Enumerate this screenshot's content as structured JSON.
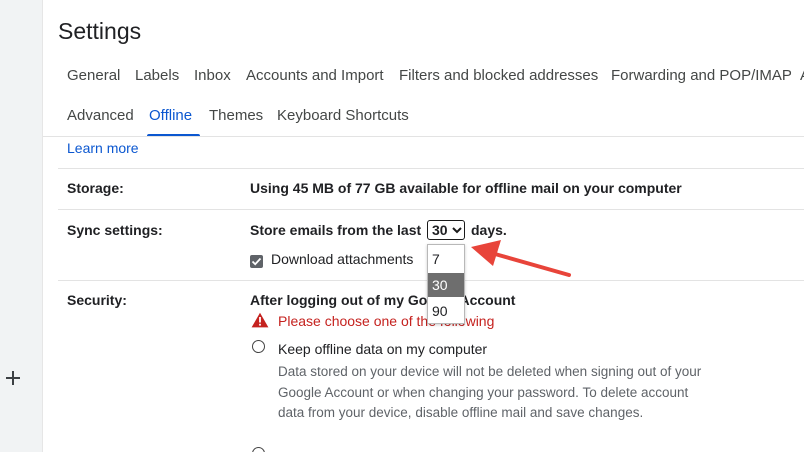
{
  "page": {
    "title": "Settings"
  },
  "tabs": {
    "row1": [
      "General",
      "Labels",
      "Inbox",
      "Accounts and Import",
      "Filters and blocked addresses",
      "Forwarding and POP/IMAP",
      "A"
    ],
    "row2": [
      "Advanced",
      "Offline",
      "Themes",
      "Keyboard Shortcuts"
    ],
    "active": "Offline"
  },
  "learn_more": "Learn more",
  "storage": {
    "label": "Storage:",
    "text": "Using 45 MB of 77 GB available for offline mail on your computer"
  },
  "sync": {
    "label": "Sync settings:",
    "prefix": "Store emails from the last",
    "selected_value": "30",
    "suffix": "days.",
    "options": [
      "7",
      "30",
      "90"
    ],
    "download_attachments_label": "Download attachments",
    "download_attachments_checked": true
  },
  "security": {
    "label": "Security:",
    "heading": "After logging out of my Google Account",
    "warning": "Please choose one of the following",
    "option1_label": "Keep offline data on my computer",
    "option1_desc": "Data stored on your device will not be deleted when signing out of your Google Account or when changing your password. To delete account data from your device, disable offline mail and save changes."
  },
  "colors": {
    "accent": "#0b57d0",
    "warning": "#c5221f",
    "arrow": "#e8443a"
  },
  "icons": [
    "plus-icon",
    "chevron-down-icon",
    "checkmark-icon",
    "warning-icon",
    "arrow-annotation"
  ]
}
